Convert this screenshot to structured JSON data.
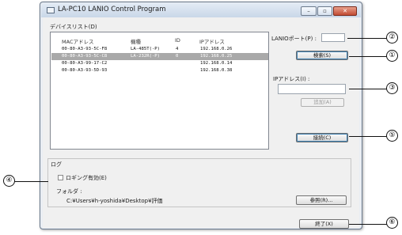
{
  "window": {
    "title": "LA-PC10 LANIO Control Program",
    "controls": {
      "minimize": "–",
      "maximize": "▫",
      "close": "✕"
    }
  },
  "device_list": {
    "label": "デバイスリスト(D)",
    "columns": [
      "MACアドレス",
      "機種",
      "ID",
      "IPアドレス"
    ],
    "rows": [
      {
        "mac": "00-80-A3-93-5C-F8",
        "model": "LA-485T(-P)",
        "id": "4",
        "ip": "192.168.0.26",
        "selected": false
      },
      {
        "mac": "00-80-A3-93-5C-C8",
        "model": "LA-232R(-P)",
        "id": "0",
        "ip": "192.168.0.25",
        "selected": true
      },
      {
        "mac": "00-80-A3-99-17-C2",
        "model": "",
        "id": "",
        "ip": "192.168.0.14",
        "selected": false
      },
      {
        "mac": "00-80-A3-93-5D-93",
        "model": "",
        "id": "",
        "ip": "192.168.0.38",
        "selected": false
      }
    ]
  },
  "right_panel": {
    "port_label": "LANIOポート(P) :",
    "port_value": "",
    "search_button": "検索(S)",
    "ip_label": "IPアドレス(I) :",
    "ip_value": "",
    "add_button": "追加(A)",
    "connect_button": "接続(C)"
  },
  "log_group": {
    "title": "ログ",
    "checkbox_label": "ロギング有効(E)",
    "checkbox_checked": false,
    "folder_label": "フォルダ :",
    "folder_path": "C:¥Users¥h-yoshida¥Desktop¥評価",
    "browse_button": "参照(R)..."
  },
  "exit_button": "終了(X)",
  "callouts": [
    "①",
    "②",
    "③",
    "④",
    "⑤",
    "⑥"
  ]
}
